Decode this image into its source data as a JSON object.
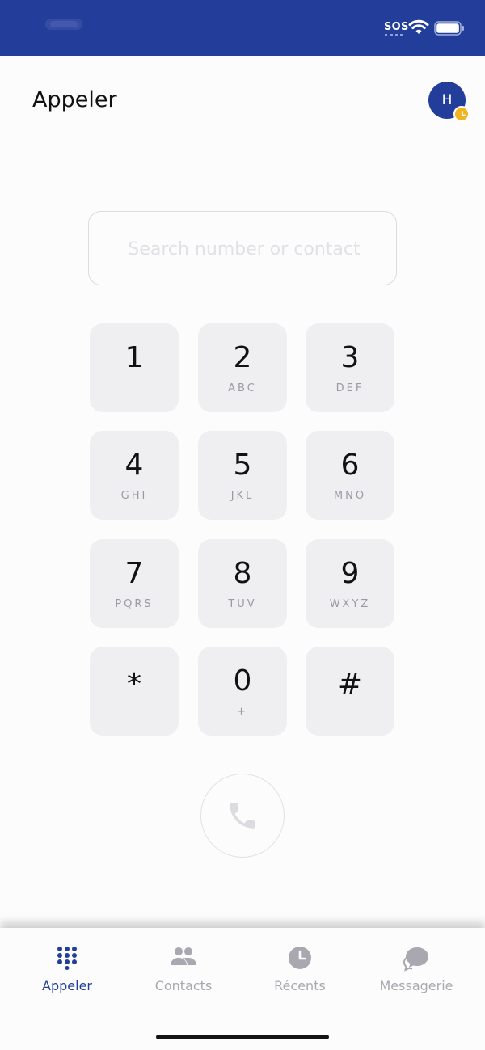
{
  "status_bar": {
    "sos": "SOS"
  },
  "header": {
    "title": "Appeler",
    "avatar_initial": "H"
  },
  "search": {
    "placeholder": "Search number or contact",
    "value": ""
  },
  "keypad": [
    {
      "digit": "1",
      "letters": ""
    },
    {
      "digit": "2",
      "letters": "ABC"
    },
    {
      "digit": "3",
      "letters": "DEF"
    },
    {
      "digit": "4",
      "letters": "GHI"
    },
    {
      "digit": "5",
      "letters": "JKL"
    },
    {
      "digit": "6",
      "letters": "MNO"
    },
    {
      "digit": "7",
      "letters": "PQRS"
    },
    {
      "digit": "8",
      "letters": "TUV"
    },
    {
      "digit": "9",
      "letters": "WXYZ"
    },
    {
      "digit": "*",
      "letters": ""
    },
    {
      "digit": "0",
      "letters": "+"
    },
    {
      "digit": "#",
      "letters": ""
    }
  ],
  "tabs": [
    {
      "label": "Appeler",
      "icon": "dialpad-icon",
      "active": true
    },
    {
      "label": "Contacts",
      "icon": "contacts-icon",
      "active": false
    },
    {
      "label": "Récents",
      "icon": "clock-icon",
      "active": false
    },
    {
      "label": "Messagerie",
      "icon": "chat-icon",
      "active": false
    }
  ],
  "colors": {
    "brand": "#233e9a",
    "presence": "#f2b520",
    "key_background": "#efeff1",
    "inactive": "#a9a8b0"
  }
}
